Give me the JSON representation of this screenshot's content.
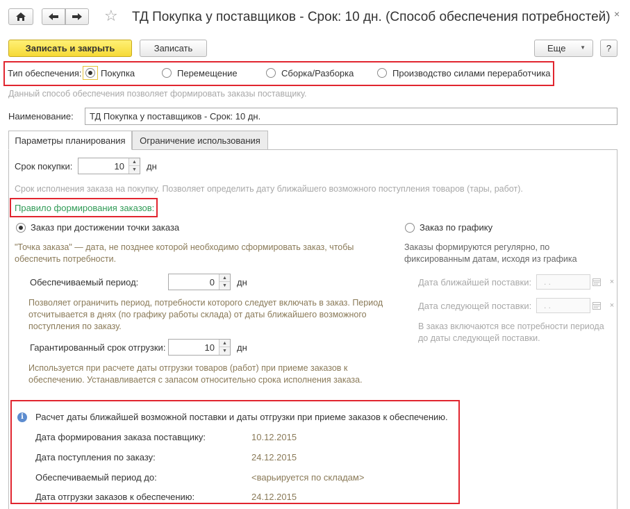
{
  "header": {
    "home_icon": "home-icon",
    "back_icon": "arrow-left-icon",
    "forward_icon": "arrow-right-icon",
    "star_icon": "star-icon",
    "title": "ТД Покупка у поставщиков - Срок: 10 дн. (Способ обеспечения потребностей)",
    "close": "×"
  },
  "toolbar": {
    "save_close": "Записать и закрыть",
    "save": "Записать",
    "more": "Еще",
    "more_arrow": "▼",
    "help": "?"
  },
  "supply_type": {
    "label": "Тип обеспечения:",
    "options": [
      "Покупка",
      "Перемещение",
      "Сборка/Разборка",
      "Производство силами переработчика"
    ],
    "selected": "Покупка",
    "hint": "Данный способ обеспечения позволяет формировать заказы поставщику."
  },
  "name_field": {
    "label": "Наименование:",
    "value": "ТД Покупка у поставщиков - Срок: 10 дн."
  },
  "tabs": [
    {
      "label": "Параметры планирования",
      "active": true
    },
    {
      "label": "Ограничение использования",
      "active": false
    }
  ],
  "planning": {
    "term_label": "Срок покупки:",
    "term_value": "10",
    "term_unit": "дн",
    "term_hint": "Срок исполнения заказа на покупку. Позволяет определить дату ближайшего возможного поступления товаров (тары, работ).",
    "rule_label": "Правило формирования заказов:",
    "order_point": {
      "label": "Заказ при достижении точки заказа",
      "selected": true,
      "hint": "\"Точка заказа\" — дата, не позднее которой необходимо сформировать заказ, чтобы обеспечить потребности.",
      "period_label": "Обеспечиваемый период:",
      "period_value": "0",
      "period_unit": "дн",
      "period_hint": "Позволяет ограничить период, потребности которого следует включать в заказ. Период отсчитывается в днях (по графику работы склада) от даты ближайшего возможного поступления по заказу.",
      "ship_label": "Гарантированный срок отгрузки:",
      "ship_value": "10",
      "ship_unit": "дн",
      "ship_hint": "Используется при расчете даты отгрузки товаров (работ) при приеме заказов к обеспечению. Устанавливается с запасом относительно срока исполнения заказа."
    },
    "schedule": {
      "label": "Заказ по графику",
      "selected": false,
      "hint": "Заказы формируются регулярно, по фиксированным датам, исходя из графика",
      "next_delivery_label": "Дата ближайшей поставки:",
      "next_delivery_value": " .  .",
      "following_delivery_label": "Дата следующей поставки:",
      "following_delivery_value": " .  .",
      "period_hint": "В заказ включаются все потребности периода до даты следующей поставки."
    }
  },
  "calc": {
    "info_icon": "info-icon",
    "heading": "Расчет даты ближайшей возможной поставки и даты отгрузки при приеме заказов к обеспечению.",
    "rows": [
      {
        "label": "Дата формирования заказа поставщику:",
        "value": "10.12.2015"
      },
      {
        "label": "Дата поступления по заказу:",
        "value": "24.12.2015"
      },
      {
        "label": "Обеспечиваемый период до:",
        "value": "<варьируется по складам>"
      },
      {
        "label": "Дата отгрузки заказов к обеспечению:",
        "value": "24.12.2015"
      }
    ]
  },
  "colors": {
    "highlight": "#e1252f",
    "primary_button": "#f6d936",
    "group_label": "#2f9a55",
    "hint_text": "#8a7a58"
  }
}
